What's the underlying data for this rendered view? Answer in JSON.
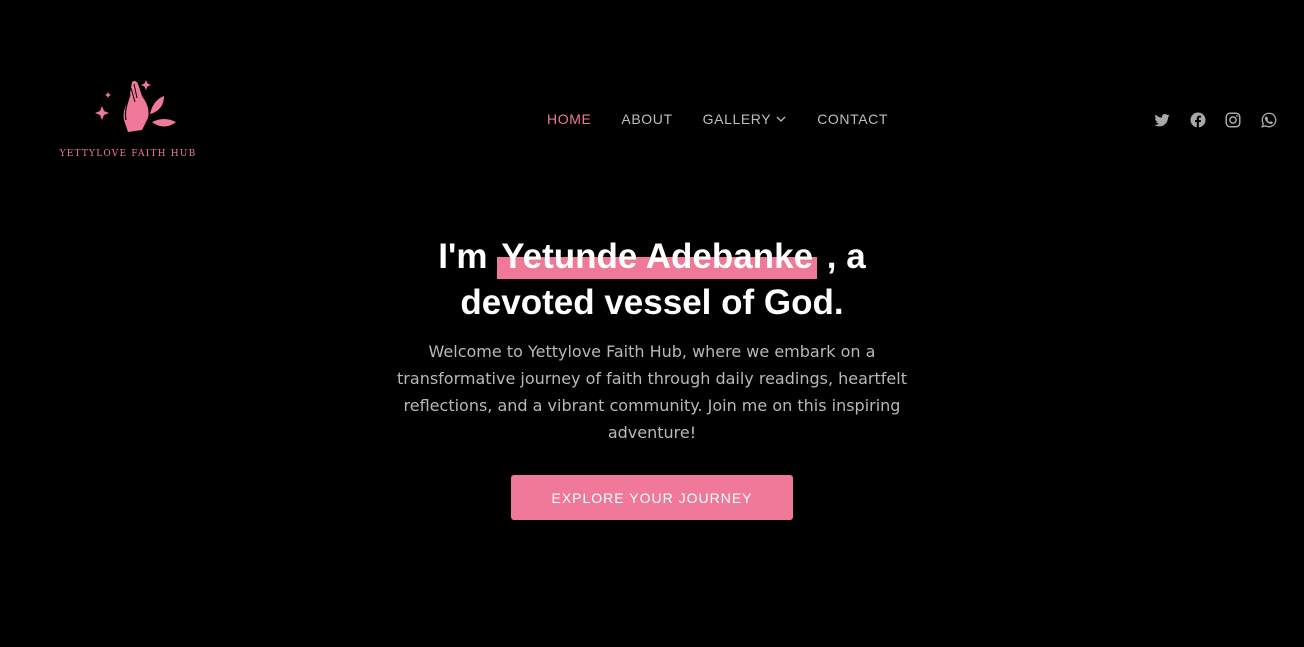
{
  "brand": {
    "name": "YETTYLOVE FAITH HUB",
    "logo_icon": "praying-hands-icon",
    "accent_color": "#f07898"
  },
  "nav": {
    "items": [
      {
        "label": "HOME",
        "active": true
      },
      {
        "label": "ABOUT",
        "active": false
      },
      {
        "label": "GALLERY",
        "active": false,
        "has_dropdown": true
      },
      {
        "label": "CONTACT",
        "active": false
      }
    ]
  },
  "socials": [
    {
      "icon": "twitter-icon"
    },
    {
      "icon": "facebook-icon"
    },
    {
      "icon": "instagram-icon"
    },
    {
      "icon": "whatsapp-icon"
    }
  ],
  "hero": {
    "title_prefix": "I'm",
    "title_name": "Yetunde Adebanke",
    "title_suffix_1": ", a",
    "title_line_2": "devoted vessel of God.",
    "subtitle": "Welcome to Yettylove Faith Hub, where we embark on a transformative journey of faith through daily readings, heartfelt reflections, and a vibrant community. Join me on this inspiring adventure!",
    "cta_label": "EXPLORE YOUR JOURNEY"
  },
  "colors": {
    "background": "#000000",
    "nav_text": "#bdbdbd",
    "icon": "#a8a8a8"
  }
}
